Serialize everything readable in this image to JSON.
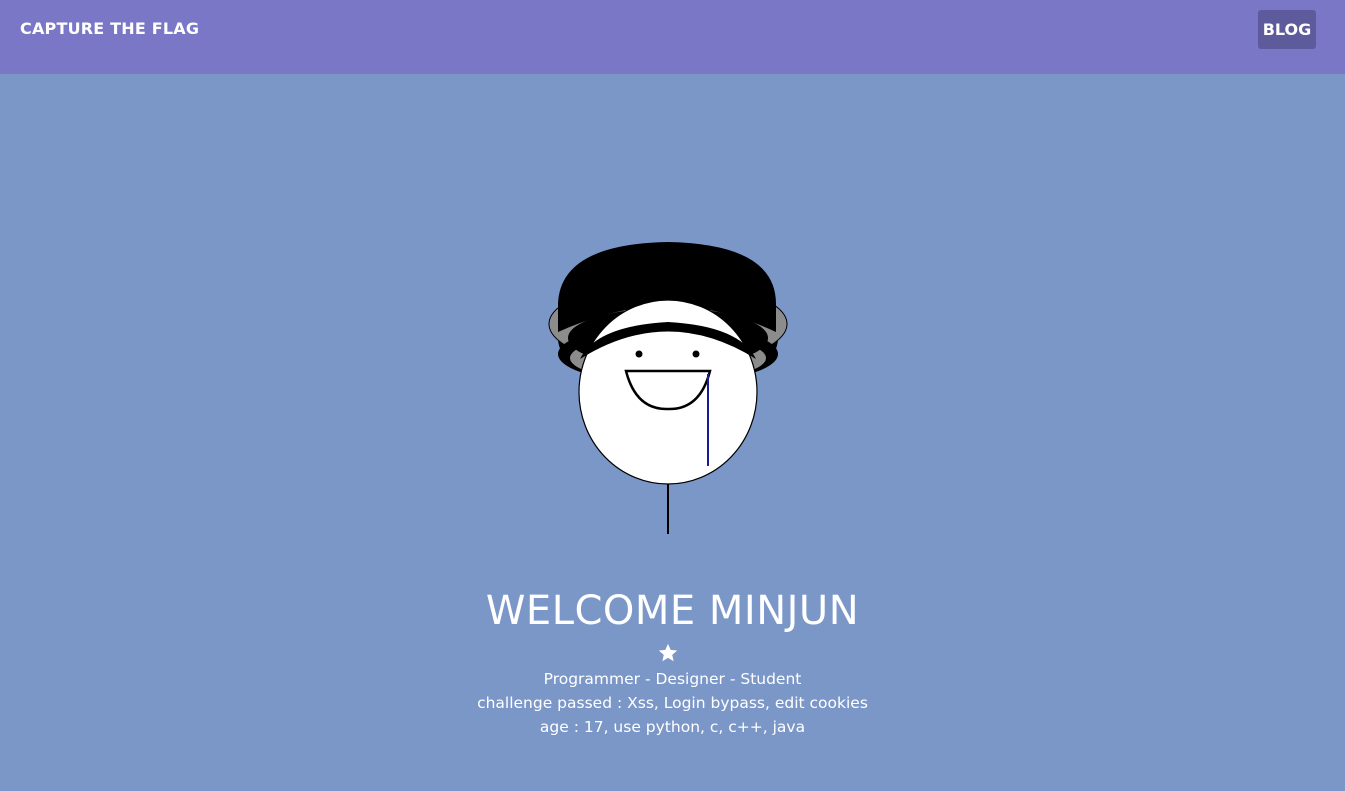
{
  "navbar": {
    "brand": "CAPTURE THE FLAG",
    "blog_label": "BLOG"
  },
  "hero": {
    "title": "WELCOME MINJUN",
    "icon": "star-icon",
    "subtitle": "Programmer - Designer - Student",
    "challenges": "challenge passed : Xss, Login bypass, edit cookies",
    "about": "age : 17, use python, c, c++, java"
  },
  "colors": {
    "navbar_bg": "#7a78c6",
    "page_bg": "#7b97c8",
    "blog_button_bg": "#5d5b9c",
    "text": "#ffffff"
  }
}
